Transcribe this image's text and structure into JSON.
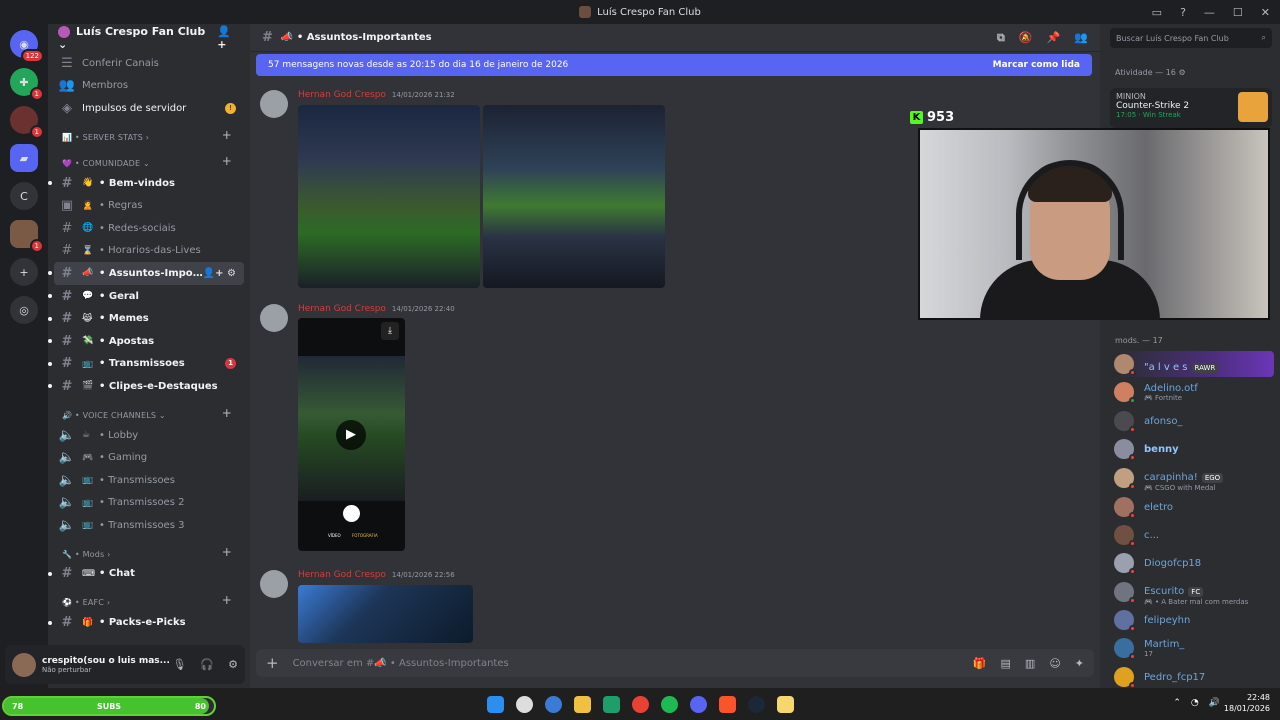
{
  "window": {
    "title": "Luís Crespo Fan Club"
  },
  "guilds": {
    "dm_badge": "122",
    "b1": "1",
    "b2": "1",
    "b3": "1",
    "c_label": "C",
    "plus": "+",
    "compass": "◎"
  },
  "server": {
    "name": "Luís Crespo Fan Club"
  },
  "sidebar": {
    "top_items": [
      {
        "label": "Conferir Canais"
      },
      {
        "label": "Membros"
      },
      {
        "label": "Impulsos de servidor"
      }
    ],
    "cat_server_stats": "SERVER STATS",
    "cat_comunidade": "COMUNIDADE",
    "channels": [
      {
        "emoji": "👋",
        "label": "• Bem-vindos"
      },
      {
        "emoji": "🙎",
        "label": "• Regras"
      },
      {
        "emoji": "🌐",
        "label": "• Redes-sociais"
      },
      {
        "emoji": "⌛",
        "label": "• Horarios-das-Lives"
      },
      {
        "emoji": "📣",
        "label": "• Assuntos-Importantes"
      },
      {
        "emoji": "💬",
        "label": "• Geral"
      },
      {
        "emoji": "😹",
        "label": "• Memes"
      },
      {
        "emoji": "💸",
        "label": "• Apostas"
      },
      {
        "emoji": "📺",
        "label": "• Transmissoes",
        "badge": "1"
      },
      {
        "emoji": "🎬",
        "label": "• Clipes-e-Destaques"
      }
    ],
    "cat_voice": "VOICE CHANNELS",
    "voice": [
      {
        "emoji": "☕",
        "label": "• Lobby"
      },
      {
        "emoji": "🎮",
        "label": "• Gaming"
      },
      {
        "emoji": "📺",
        "label": "• Transmissoes"
      },
      {
        "emoji": "📺",
        "label": "• Transmissoes 2"
      },
      {
        "emoji": "📺",
        "label": "• Transmissoes 3"
      }
    ],
    "cat_mods": "Mods",
    "mods_channels": [
      {
        "emoji": "⌨",
        "label": "• Chat"
      }
    ],
    "cat_eafc": "EAFC",
    "eafc_channels": [
      {
        "emoji": "🎁",
        "label": "• Packs-e-Picks"
      }
    ]
  },
  "user_panel": {
    "name": "crespito(sou o luis mas...",
    "status": "Não perturbar"
  },
  "channel": {
    "name": "📣 • Assuntos-Importantes"
  },
  "new_messages": {
    "text": "57 mensagens novas desde as 20:15 do dia 16 de janeiro de 2026",
    "action": "Marcar como lida"
  },
  "messages": [
    {
      "author": "Hernan God Crespo",
      "time": "14/01/2026 21:32"
    },
    {
      "author": "Hernan God Crespo",
      "time": "14/01/2026 22:40"
    },
    {
      "author": "Hernan God Crespo",
      "time": "14/01/2026 22:56"
    }
  ],
  "video": {
    "mode1": "VÍDEO",
    "mode2": "FOTOGRAFIA"
  },
  "composer": {
    "placeholder": "Conversar em #📣 • Assuntos-Importantes"
  },
  "members": {
    "search_placeholder": "Buscar Luís Crespo Fan Club",
    "activity": "Atividade — 16 ⚙",
    "act_user": "MINION",
    "act_game": "Counter-Strike 2",
    "act_detail": "17:05 · Win Streak",
    "mods_label": "mods. — 17",
    "list": [
      {
        "name": "\"a l v e s",
        "sub": "",
        "tag": "RAWR",
        "color": "#8ec7ff"
      },
      {
        "name": "Adelino.otf",
        "sub": "🎮 Fortnite",
        "tag": "",
        "color": "#6aa6de"
      },
      {
        "name": "afonso_",
        "sub": "",
        "tag": "",
        "color": "#6aa6de"
      },
      {
        "name": "benny",
        "sub": "",
        "tag": "",
        "color": "#8ec7ff"
      },
      {
        "name": "carapinha!",
        "sub": "🎮 CSGO with Medal",
        "tag": "EGO",
        "color": "#6aa6de"
      },
      {
        "name": "eletro",
        "sub": "",
        "tag": "",
        "color": "#6aa6de"
      },
      {
        "name": "c...",
        "sub": "",
        "tag": "",
        "color": "#6aa6de"
      },
      {
        "name": "Diogofcp18",
        "sub": "",
        "tag": "",
        "color": "#6aa6de"
      },
      {
        "name": "Escurito",
        "sub": "🎮 • A Bater mal com merdas",
        "tag": "FC",
        "color": "#6aa6de"
      },
      {
        "name": "felipeyhn",
        "sub": "",
        "tag": "",
        "color": "#6aa6de"
      },
      {
        "name": "Martim_",
        "sub": "17",
        "tag": "",
        "color": "#6aa6de"
      },
      {
        "name": "Pedro_fcp17",
        "sub": "",
        "tag": "",
        "color": "#6aa6de"
      }
    ]
  },
  "overlay": {
    "kick_count": "953"
  },
  "subs_bar": {
    "left": "78",
    "label": "SUBS",
    "right": "80",
    "progress": 0.975
  },
  "clock": {
    "time": "22:48",
    "date": "18/01/2026"
  },
  "colors": {
    "accent": "#5865f2",
    "author": "#d63c3c",
    "online": "#23a55a",
    "dnd": "#f23f43"
  }
}
